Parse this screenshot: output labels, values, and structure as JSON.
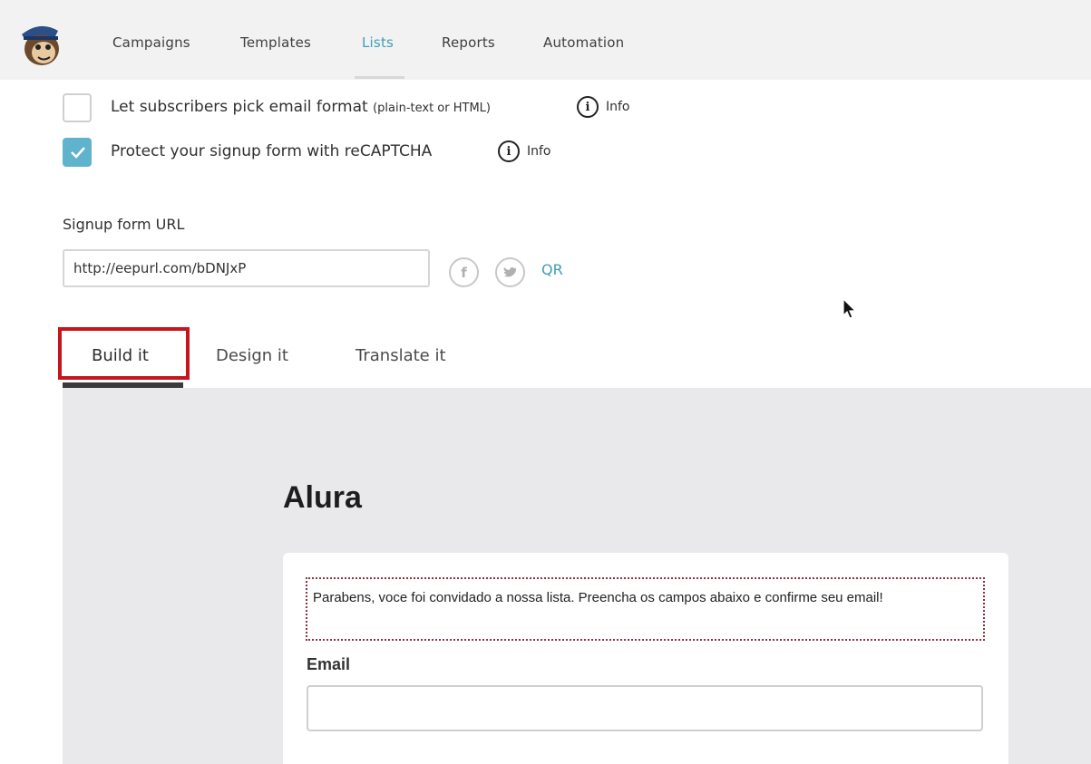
{
  "nav": {
    "items": [
      {
        "label": "Campaigns",
        "active": false
      },
      {
        "label": "Templates",
        "active": false
      },
      {
        "label": "Lists",
        "active": true
      },
      {
        "label": "Reports",
        "active": false
      },
      {
        "label": "Automation",
        "active": false
      }
    ]
  },
  "options": {
    "email_format": {
      "label": "Let subscribers pick email format",
      "hint": "(plain-text or HTML)",
      "checked": false,
      "info_label": "Info"
    },
    "recaptcha": {
      "label": "Protect your signup form with reCAPTCHA",
      "checked": true,
      "info_label": "Info"
    }
  },
  "signup_url": {
    "label": "Signup form URL",
    "value": "http://eepurl.com/bDNJxP",
    "qr_label": "QR"
  },
  "tabs": [
    {
      "label": "Build it",
      "active": true
    },
    {
      "label": "Design it",
      "active": false
    },
    {
      "label": "Translate it",
      "active": false
    }
  ],
  "form_preview": {
    "title": "Alura",
    "message": "Parabens, voce foi convidado a nossa lista. Preencha os campos abaixo e confirme seu email!",
    "email_label": "Email",
    "email_value": ""
  },
  "colors": {
    "accent": "#3f9eb5",
    "checkbox_checked": "#5fb3cc",
    "highlight": "#c8141c"
  }
}
